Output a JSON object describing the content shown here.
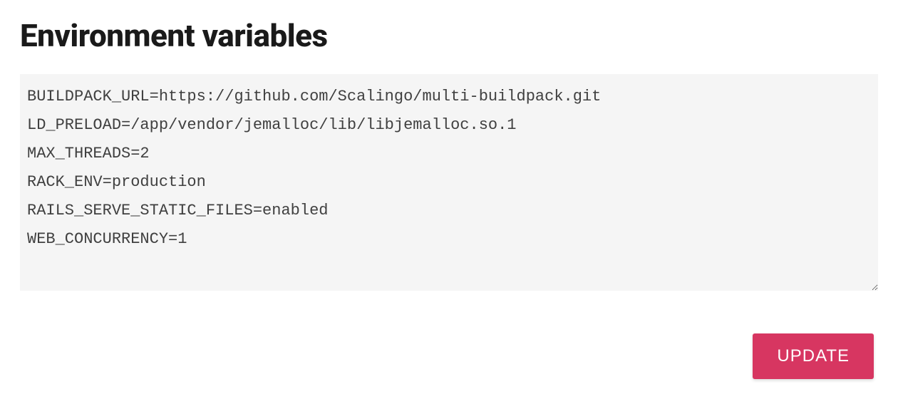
{
  "header": {
    "title": "Environment variables"
  },
  "env": {
    "content": "BUILDPACK_URL=https://github.com/Scalingo/multi-buildpack.git\nLD_PRELOAD=/app/vendor/jemalloc/lib/libjemalloc.so.1\nMAX_THREADS=2\nRACK_ENV=production\nRAILS_SERVE_STATIC_FILES=enabled\nWEB_CONCURRENCY=1"
  },
  "actions": {
    "update_label": "UPDATE"
  }
}
